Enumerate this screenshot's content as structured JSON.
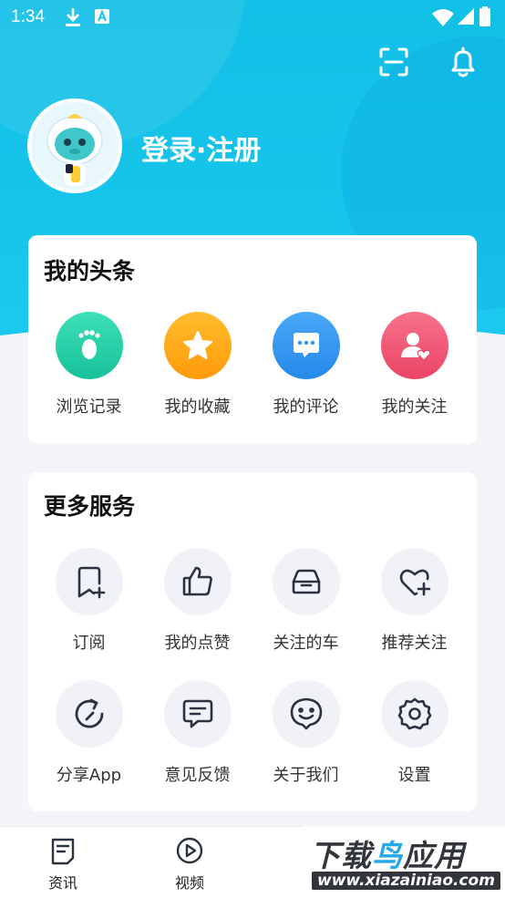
{
  "status_bar": {
    "time": "1:34"
  },
  "profile": {
    "login_label": "登录·注册"
  },
  "my_toutiao": {
    "title": "我的头条",
    "items": [
      {
        "label": "浏览记录",
        "icon": "footprint-icon",
        "color": "#1fcfa6"
      },
      {
        "label": "我的收藏",
        "icon": "star-icon",
        "color": "#ffa415"
      },
      {
        "label": "我的评论",
        "icon": "comment-icon",
        "color": "#2f95f0"
      },
      {
        "label": "我的关注",
        "icon": "follow-user-icon",
        "color": "#f05a75"
      }
    ]
  },
  "more_services": {
    "title": "更多服务",
    "items": [
      {
        "label": "订阅",
        "icon": "bookmark-add-icon"
      },
      {
        "label": "我的点赞",
        "icon": "thumbs-up-icon"
      },
      {
        "label": "关注的车",
        "icon": "car-icon"
      },
      {
        "label": "推荐关注",
        "icon": "heart-add-icon"
      },
      {
        "label": "分享App",
        "icon": "share-icon"
      },
      {
        "label": "意见反馈",
        "icon": "feedback-icon"
      },
      {
        "label": "关于我们",
        "icon": "smile-icon"
      },
      {
        "label": "设置",
        "icon": "gear-icon"
      }
    ]
  },
  "tabs": [
    {
      "label": "资讯",
      "icon": "news-icon"
    },
    {
      "label": "视频",
      "icon": "video-icon"
    }
  ],
  "watermark": {
    "title_a": "下载",
    "title_b": "鸟",
    "title_c": "应用",
    "url": "www.xiazainiao.com"
  }
}
